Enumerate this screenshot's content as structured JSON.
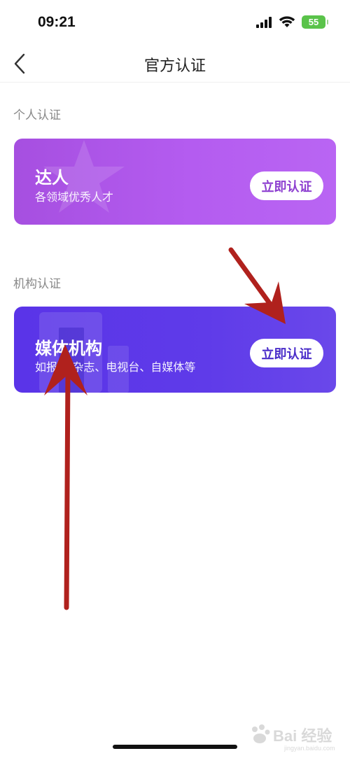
{
  "status": {
    "time": "09:21",
    "battery": "55"
  },
  "nav": {
    "title": "官方认证"
  },
  "sections": [
    {
      "label": "个人认证",
      "card": {
        "title": "达人",
        "subtitle": "各领域优秀人才",
        "button": "立即认证"
      }
    },
    {
      "label": "机构认证",
      "card": {
        "title": "媒体机构",
        "subtitle": "如报刊/杂志、电视台、自媒体等",
        "button": "立即认证"
      }
    }
  ],
  "watermark": {
    "brand": "Bai 经验",
    "site": "jingyan.baidu.com"
  },
  "colors": {
    "talent_card": "#b05af0",
    "media_card": "#5d38e9",
    "annotation_arrow": "#b0211d"
  }
}
